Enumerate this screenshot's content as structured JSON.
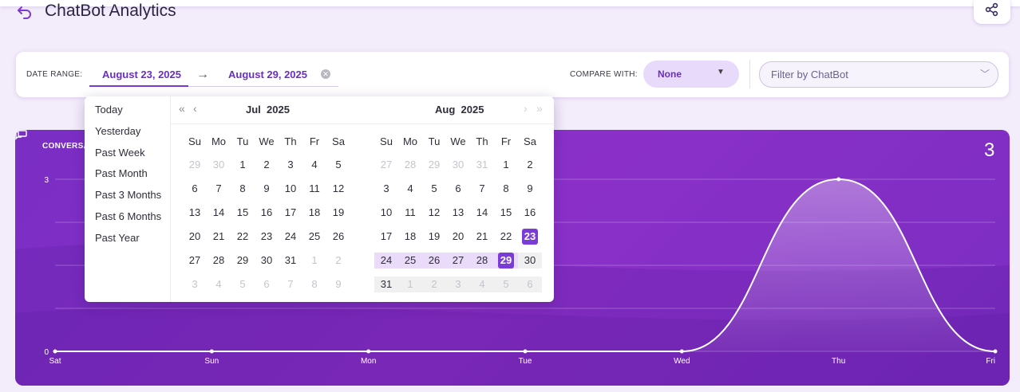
{
  "header": {
    "title": "ChatBot Analytics"
  },
  "filter": {
    "date_range_label": "DATE RANGE:",
    "start_date": "August 23, 2025",
    "end_date": "August 29, 2025",
    "arrow": "→",
    "compare_label": "COMPARE WITH:",
    "compare_value": "None",
    "chatbot_placeholder": "Filter by ChatBot"
  },
  "picker": {
    "presets": [
      "Today",
      "Yesterday",
      "Past Week",
      "Past Month",
      "Past 3 Months",
      "Past 6 Months",
      "Past Year"
    ],
    "weekdays": [
      "Su",
      "Mo",
      "Tu",
      "We",
      "Th",
      "Fr",
      "Sa"
    ],
    "left_month": {
      "month": "Jul",
      "year": "2025",
      "days": [
        [
          "29",
          "30",
          "1",
          "2",
          "3",
          "4",
          "5"
        ],
        [
          "6",
          "7",
          "8",
          "9",
          "10",
          "11",
          "12"
        ],
        [
          "13",
          "14",
          "15",
          "16",
          "17",
          "18",
          "19"
        ],
        [
          "20",
          "21",
          "22",
          "23",
          "24",
          "25",
          "26"
        ],
        [
          "27",
          "28",
          "29",
          "30",
          "31",
          "1",
          "2"
        ],
        [
          "3",
          "4",
          "5",
          "6",
          "7",
          "8",
          "9"
        ]
      ]
    },
    "right_month": {
      "month": "Aug",
      "year": "2025",
      "days": [
        [
          "27",
          "28",
          "29",
          "30",
          "31",
          "1",
          "2"
        ],
        [
          "3",
          "4",
          "5",
          "6",
          "7",
          "8",
          "9"
        ],
        [
          "10",
          "11",
          "12",
          "13",
          "14",
          "15",
          "16"
        ],
        [
          "17",
          "18",
          "19",
          "20",
          "21",
          "22",
          "23"
        ],
        [
          "24",
          "25",
          "26",
          "27",
          "28",
          "29",
          "30"
        ],
        [
          "31",
          "1",
          "2",
          "3",
          "4",
          "5",
          "6"
        ]
      ]
    }
  },
  "chart_card": {
    "label": "CONVERSA",
    "total": "3"
  },
  "chart_data": {
    "type": "area",
    "x": [
      "Sat",
      "Sun",
      "Mon",
      "Tue",
      "Wed",
      "Thu",
      "Fri"
    ],
    "values": [
      0,
      0,
      0,
      0,
      0,
      3,
      0
    ],
    "ylim": [
      0,
      3
    ],
    "y_ticks": [
      "0",
      "3"
    ],
    "grid": true
  }
}
